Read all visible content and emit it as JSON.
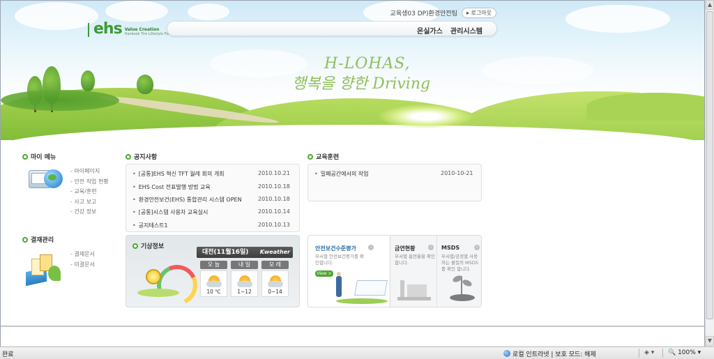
{
  "header": {
    "logo_text": "ehs",
    "logo_tagline": "Value Creation",
    "logo_subtext": "Hankook Tire Lifestyle For Health & Sustainability",
    "user_info": "교육생03 DP)환경안전팀",
    "logout_label": "로그아웃",
    "nav": [
      "온실가스",
      "관리시스템"
    ],
    "slogan_line1": "H-LOHAS,",
    "slogan_line2": "행복을 향한 Driving"
  },
  "my_menu": {
    "title": "마이 메뉴",
    "items": [
      "마이페이지",
      "안전 작업 현황",
      "교육/훈련",
      "사고 보고",
      "건강 정보"
    ]
  },
  "approval": {
    "title": "결재관리",
    "items": [
      "결재문서",
      "미결문서"
    ]
  },
  "notices": {
    "title": "공지사항",
    "rows": [
      {
        "title": "[공통]EHS 혁신 TFT 월례 회의 개최",
        "date": "2010.10.21"
      },
      {
        "title": "EHS Cost 전표발행 방법 교육",
        "date": "2010.10.18"
      },
      {
        "title": "환경안전보건(EHS) 통합관리 시스템 OPEN",
        "date": "2010.10.18"
      },
      {
        "title": "[공통]시스템 사용자 교육실시",
        "date": "2010.10.14"
      },
      {
        "title": "공지테스트1",
        "date": "2010.10.13"
      }
    ]
  },
  "training": {
    "title": "교육훈련",
    "rows": [
      {
        "title": "밀폐공간에서의 작업",
        "date": "2010-10-21"
      }
    ]
  },
  "weather": {
    "title": "기상정보",
    "location_date": "대전(11월16일)",
    "provider": "Kweather",
    "days": [
      {
        "name": "오 늘",
        "temp": "10 ℃"
      },
      {
        "name": "내 일",
        "temp": "1~12"
      },
      {
        "name": "모 레",
        "temp": "0~14"
      }
    ]
  },
  "promo": {
    "safety_eval": {
      "title": "안전보건수준평가",
      "desc": "부서별 안전보건평가를 확인합니다.",
      "button": "View >"
    },
    "smoking": {
      "title": "금연현황",
      "desc": "부서별 흡연율을 확인 합니다."
    },
    "msds": {
      "title": "MSDS",
      "desc": "부서별/공정별 사용하는 물질의 MSDS를 확인 합니다."
    }
  },
  "statusbar": {
    "status": "완료",
    "zone": "로컬 인트라넷 | 보호 모드: 해제",
    "zoom": "100%"
  },
  "colors": {
    "accent_green": "#4aa832",
    "promo_blue": "#2d6da3"
  }
}
